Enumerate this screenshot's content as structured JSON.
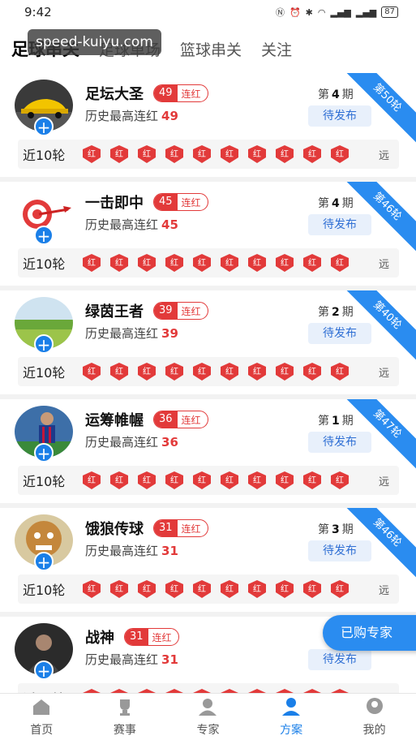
{
  "status_bar": {
    "time": "9:42",
    "battery": "87"
  },
  "watermark": "speed-kuiyu.com",
  "tabs": [
    {
      "label": "足球串关",
      "active": true
    },
    {
      "label": "足球单场",
      "active": false
    },
    {
      "label": "篮球串关",
      "active": false
    },
    {
      "label": "关注",
      "active": false
    }
  ],
  "labels": {
    "streak_suffix": "连红",
    "history_prefix": "历史最高连红",
    "period_prefix": "第",
    "period_suffix": "期",
    "pending": "待发布",
    "recent": "近10轮",
    "badge": "红",
    "more": "远"
  },
  "experts": [
    {
      "name": "足坛大圣",
      "streak": "49",
      "history": "49",
      "period": "4",
      "ribbon": "第50轮",
      "avatar": "car-avatar"
    },
    {
      "name": "一击即中",
      "streak": "45",
      "history": "45",
      "period": "4",
      "ribbon": "第46轮",
      "avatar": "dart-avatar"
    },
    {
      "name": "绿茵王者",
      "streak": "39",
      "history": "39",
      "period": "2",
      "ribbon": "第40轮",
      "avatar": "field-avatar"
    },
    {
      "name": "运筹帷幄",
      "streak": "36",
      "history": "36",
      "period": "1",
      "ribbon": "第47轮",
      "avatar": "player-avatar"
    },
    {
      "name": "饿狼传球",
      "streak": "31",
      "history": "31",
      "period": "3",
      "ribbon": "第46轮",
      "avatar": "cartoon-avatar"
    },
    {
      "name": "战神",
      "streak": "31",
      "history": "31",
      "period": "",
      "ribbon": "",
      "avatar": "person-avatar"
    }
  ],
  "fab": "已购专家",
  "bottom_nav": [
    {
      "label": "首页",
      "icon": "home-icon",
      "active": false
    },
    {
      "label": "赛事",
      "icon": "trophy-icon",
      "active": false
    },
    {
      "label": "专家",
      "icon": "expert-icon",
      "active": false
    },
    {
      "label": "方案",
      "icon": "plan-icon",
      "active": true
    },
    {
      "label": "我的",
      "icon": "profile-icon",
      "active": false
    }
  ],
  "colors": {
    "accent": "#1a7fe8",
    "red": "#e23a3a",
    "ribbon": "#2a8cf0"
  }
}
